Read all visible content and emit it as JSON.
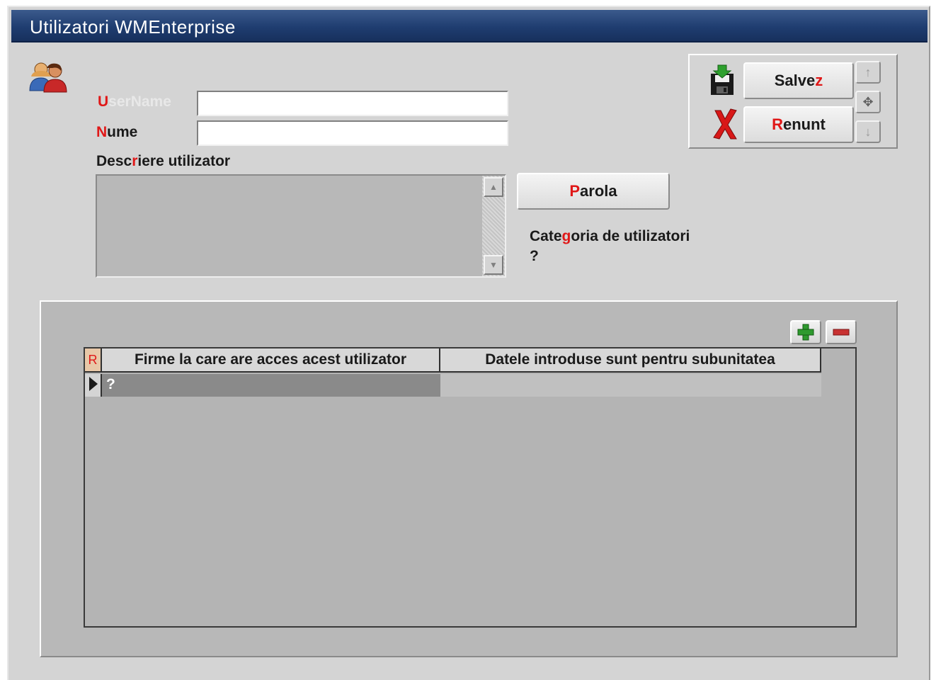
{
  "window": {
    "title": "Utilizatori WMEnterprise"
  },
  "form": {
    "username_hotkey": "U",
    "username_rest": "serName",
    "username_value": "",
    "nume_hotkey": "N",
    "nume_rest": "ume",
    "nume_value": "",
    "descriere_pre": "Desc",
    "descriere_hotkey": "r",
    "descriere_post": "iere utilizator",
    "descriere_value": "",
    "categoria_pre": "Cate",
    "categoria_hotkey": "g",
    "categoria_post": "oria de utilizatori",
    "categoria_value": "?"
  },
  "buttons": {
    "parola_hotkey": "P",
    "parola_rest": "arola",
    "salvez_pre": "Salve",
    "salvez_hotkey": "z",
    "renunt_hotkey": "R",
    "renunt_rest": "enunt"
  },
  "grid": {
    "row_indicator_header": "R",
    "columns": [
      "Firme la care are acces acest utilizator",
      "Datele introduse sunt pentru subunitatea"
    ],
    "rows": [
      {
        "firma": "?",
        "subunitate": ""
      }
    ]
  },
  "icons": {
    "users": "users-icon",
    "save": "save-disk-icon",
    "cancel": "red-x-icon",
    "nav_up": "arrow-up-icon",
    "nav_move": "move-icon",
    "nav_down": "arrow-down-icon",
    "add": "plus-icon",
    "remove": "minus-icon"
  },
  "colors": {
    "title_bar": "#1f3d70",
    "hotkey": "#e01818",
    "add_green": "#2e9a2e",
    "remove_red": "#c83232"
  }
}
